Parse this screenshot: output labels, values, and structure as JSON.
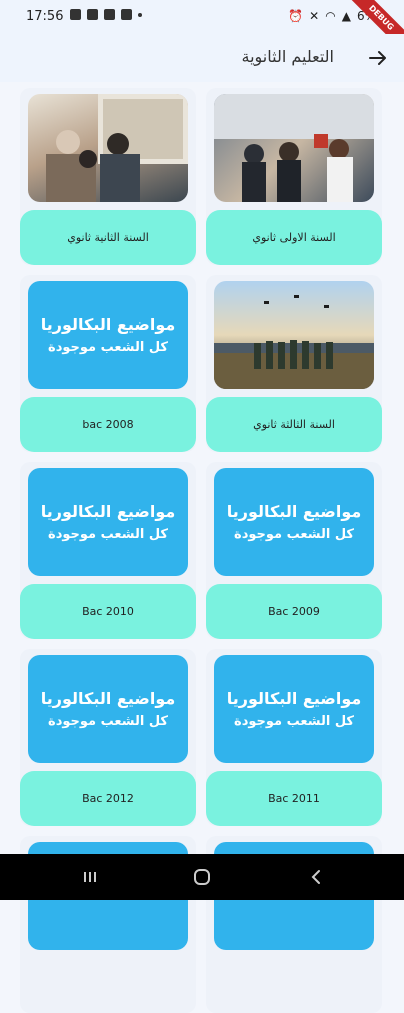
{
  "status": {
    "time": "17:56",
    "battery": "6%"
  },
  "debug_banner": "DEBUG",
  "appbar": {
    "title": "التعليم الثانوية"
  },
  "banner_text": {
    "line1": "مواضيع البكالوريا",
    "line2": "كل الشعب موجودة"
  },
  "cards": [
    {
      "label": "السنة الاولى ثانوي"
    },
    {
      "label": "السنة الثانية ثانوي"
    },
    {
      "label": "السنة الثالثة ثانوي"
    },
    {
      "label": "bac 2008"
    },
    {
      "label": "Bac 2009"
    },
    {
      "label": "Bac 2010"
    },
    {
      "label": "Bac 2011"
    },
    {
      "label": "Bac 2012"
    }
  ],
  "colors": {
    "pill": "#7af2df",
    "banner": "#31b3ec",
    "background": "#f3f6fc"
  }
}
